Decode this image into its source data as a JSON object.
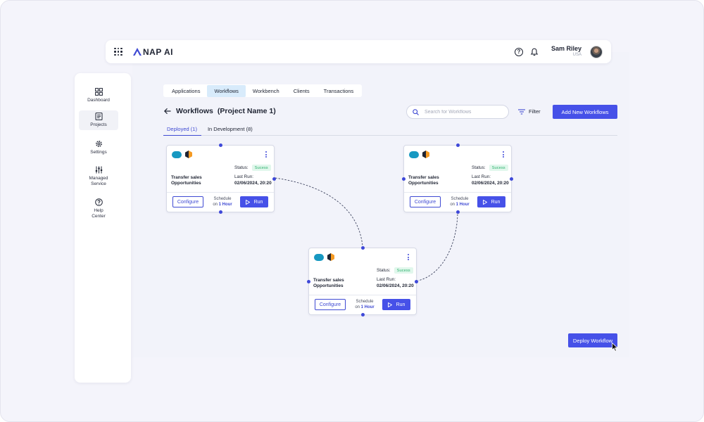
{
  "app": {
    "logo_text": "NAP AI"
  },
  "header": {
    "user_name": "Sam Riley",
    "user_location": "USA"
  },
  "sidebar": {
    "items": [
      {
        "label": "Dashboard",
        "icon": "dashboard-icon"
      },
      {
        "label": "Projects",
        "icon": "projects-icon",
        "active": true
      },
      {
        "label": "Settings",
        "icon": "gear-icon"
      },
      {
        "label": "Managed Service",
        "icon": "sliders-icon"
      },
      {
        "label": "Help Center",
        "icon": "help-icon"
      }
    ]
  },
  "tabs": [
    {
      "label": "Applications"
    },
    {
      "label": "Workflows",
      "active": true
    },
    {
      "label": "Workbench"
    },
    {
      "label": "Clients"
    },
    {
      "label": "Transactions"
    }
  ],
  "page": {
    "title": "Workflows",
    "project": "(Project Name 1)",
    "search_placeholder": "Search for Workflows",
    "filter_label": "Filter",
    "add_button": "Add New Workflows",
    "deploy_button": "Deploy Workflow"
  },
  "subtabs": [
    {
      "label": "Deployed (1)",
      "active": true
    },
    {
      "label": "In Development (8)"
    }
  ],
  "cards": [
    {
      "name_line1": "Transfer sales",
      "name_line2": "Opportunities",
      "status_label": "Status:",
      "status": "Sucess",
      "last_run_label": "Last Run:",
      "last_run": "02/06/2024, 20:20",
      "configure": "Configure",
      "schedule_line1": "Schedule",
      "schedule_on": "on",
      "schedule_value": "1 Hour",
      "run": "Run"
    },
    {
      "name_line1": "Transfer sales",
      "name_line2": "Opportunities",
      "status_label": "Status:",
      "status": "Sucess",
      "last_run_label": "Last Run:",
      "last_run": "02/06/2024, 20:20",
      "configure": "Configure",
      "schedule_line1": "Schedule",
      "schedule_on": "on",
      "schedule_value": "1 Hour",
      "run": "Run"
    },
    {
      "name_line1": "Transfer sales",
      "name_line2": "Opportunities",
      "status_label": "Status:",
      "status": "Sucess",
      "last_run_label": "Last Run:",
      "last_run": "02/06/2024, 20:20",
      "configure": "Configure",
      "schedule_line1": "Schedule",
      "schedule_on": "on",
      "schedule_value": "1 Hour",
      "run": "Run"
    }
  ],
  "colors": {
    "primary": "#4651e8",
    "success_bg": "#e1f7ec",
    "success_text": "#2fb36e",
    "active_tab": "#d8ebfb"
  }
}
